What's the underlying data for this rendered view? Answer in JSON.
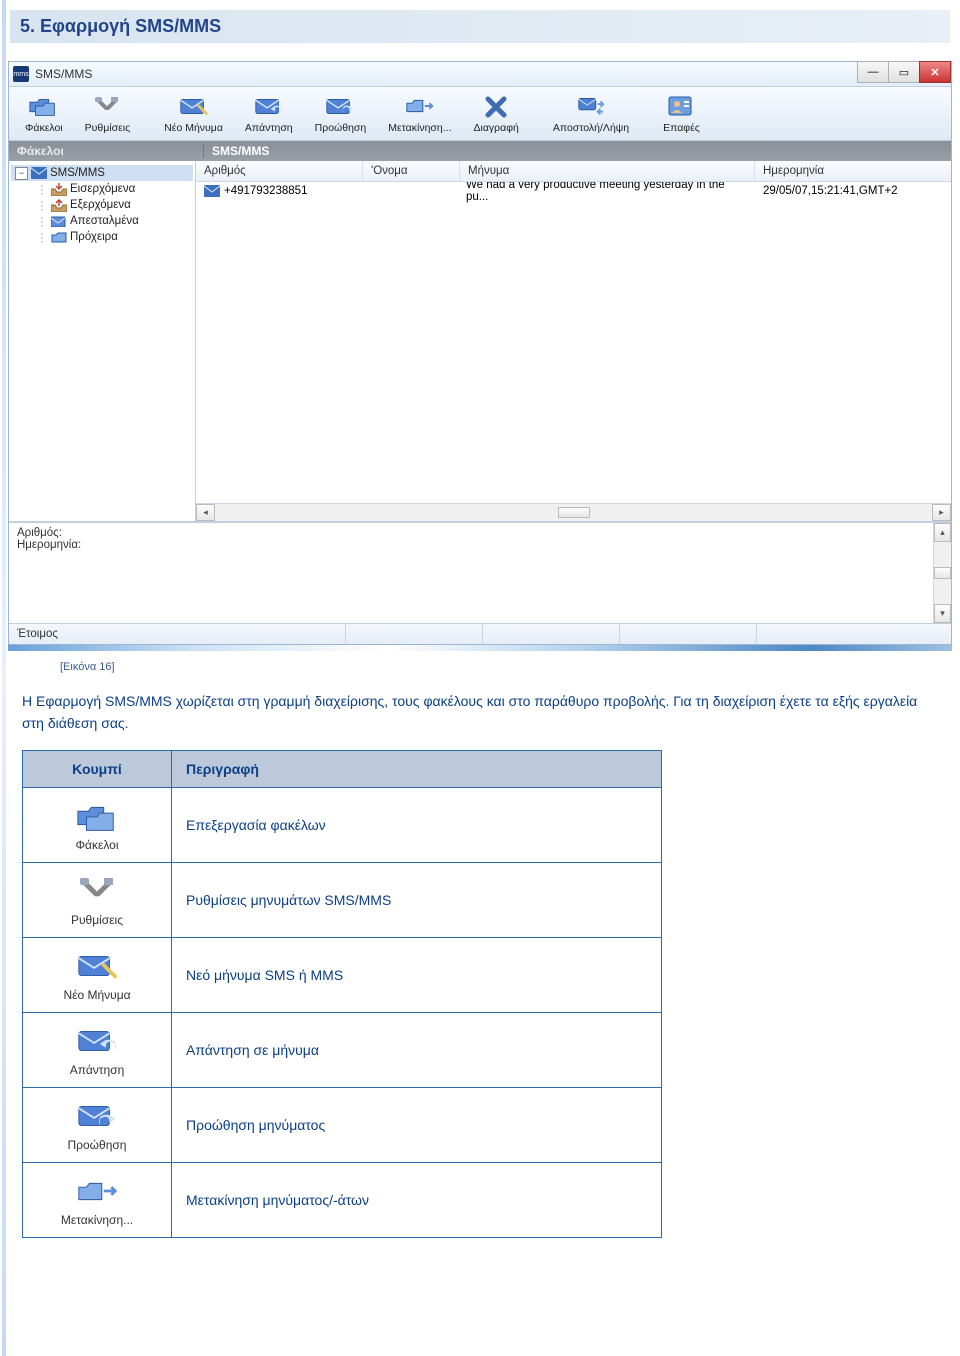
{
  "page": {
    "section_title": "5. Εφαρμογή SMS/MMS",
    "caption": "[Εικόνα 16]",
    "paragraph": "Η Εφαρμογή SMS/MMS χωρίζεται στη γραμμή διαχείρισης, τους φακέλους και στο παράθυρο προβολής. Για τη διαχείριση έχετε τα εξής εργαλεία στη διάθεση σας."
  },
  "window": {
    "title": "SMS/MMS",
    "status": "Έτοιμος",
    "panels": {
      "left_title": "Φάκελοι",
      "right_title": "SMS/MMS"
    },
    "detail": {
      "line1": "Αριθμός:",
      "line2": "Ημερομηνία:"
    }
  },
  "toolbar": [
    {
      "key": "folders",
      "label": "Φάκελοι"
    },
    {
      "key": "settings",
      "label": "Ρυθμίσεις"
    },
    {
      "key": "new",
      "label": "Νέο Μήνυμα"
    },
    {
      "key": "reply",
      "label": "Απάντηση"
    },
    {
      "key": "forward",
      "label": "Προώθηση"
    },
    {
      "key": "move",
      "label": "Μετακίνηση..."
    },
    {
      "key": "delete",
      "label": "Διαγραφή"
    },
    {
      "key": "sendrecv",
      "label": "Αποστολή/Λήψη"
    },
    {
      "key": "contacts",
      "label": "Επαφές"
    }
  ],
  "tree": {
    "root": "SMS/MMS",
    "children": [
      {
        "label": "Εισερχόμενα"
      },
      {
        "label": "Εξερχόμενα"
      },
      {
        "label": "Απεσταλμένα"
      },
      {
        "label": "Πρόχειρα"
      }
    ]
  },
  "columns": {
    "number": "Αριθμός",
    "name": "'Ονομα",
    "message": "Μήνυμα",
    "date": "Ημερομηνία"
  },
  "messages": [
    {
      "number": "+491793238851",
      "name": "",
      "message": "We had a very productive meeting yesterday in the pu...",
      "date": "29/05/07,15:21:41,GMT+2"
    }
  ],
  "desc_table": {
    "head_button": "Κουμπί",
    "head_desc": "Περιγραφή",
    "rows": [
      {
        "icon": "folders",
        "icon_label": "Φάκελοι",
        "desc": "Επεξεργασία φακέλων"
      },
      {
        "icon": "settings",
        "icon_label": "Ρυθμίσεις",
        "desc": "Ρυθμίσεις μηνυμάτων SMS/MMS"
      },
      {
        "icon": "new",
        "icon_label": "Νέο Μήνυμα",
        "desc": "Νεό μήνυμα SMS ή MMS"
      },
      {
        "icon": "reply",
        "icon_label": "Απάντηση",
        "desc": "Απάντηση σε μήνυμα"
      },
      {
        "icon": "forward",
        "icon_label": "Προώθηση",
        "desc": "Προώθηση μηνύματος"
      },
      {
        "icon": "move",
        "icon_label": "Μετακίνηση...",
        "desc": "Μετακίνηση μηνύματος/-άτων"
      }
    ]
  }
}
